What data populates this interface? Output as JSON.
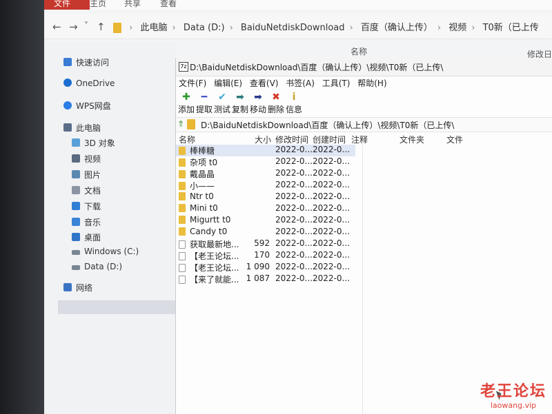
{
  "explorer": {
    "ribbon_tabs": [
      "文件",
      "主页",
      "共享",
      "查看"
    ],
    "nav_buttons": [
      "←",
      "→",
      "˅",
      "↑"
    ],
    "breadcrumbs": [
      "此电脑",
      "Data (D:)",
      "BaiduNetdiskDownload",
      "百度（确认上传）",
      "视频",
      "T0新（已上传"
    ],
    "column_name": "名称",
    "column_modified": "修改日",
    "nav_items": [
      {
        "label": "快速访问",
        "color": "#3a7bd5"
      },
      {
        "label": "OneDrive",
        "color": "#1b6fd1"
      },
      {
        "label": "WPS网盘",
        "color": "#2c7ee6"
      },
      {
        "label": "此电脑",
        "color": "#5a6d8a"
      },
      {
        "label": "3D 对象",
        "color": "#5aa0d8"
      },
      {
        "label": "视频",
        "color": "#5b6b80"
      },
      {
        "label": "图片",
        "color": "#5b88b0"
      },
      {
        "label": "文档",
        "color": "#8a94a3"
      },
      {
        "label": "下载",
        "color": "#2f7fd6"
      },
      {
        "label": "音乐",
        "color": "#3a84d8"
      },
      {
        "label": "桌面",
        "color": "#2f74c8"
      },
      {
        "label": "Windows (C:)",
        "color": "#7a8593"
      },
      {
        "label": "Data (D:)",
        "color": "#7a8593"
      },
      {
        "label": "网络",
        "color": "#3b74c4"
      }
    ]
  },
  "archiver": {
    "title": "D:\\BaiduNetdiskDownload\\百度（确认上传）\\视频\\T0新（已上传\\",
    "app_icon": "7z",
    "menu": [
      "文件(F)",
      "编辑(E)",
      "查看(V)",
      "书签(A)",
      "工具(T)",
      "帮助(H)"
    ],
    "toolbar": [
      {
        "label": "添加",
        "icon": "plus-icon",
        "glyph": "✚",
        "color": "#2e9a2e"
      },
      {
        "label": "提取",
        "icon": "minus-icon",
        "glyph": "━",
        "color": "#4a55c8"
      },
      {
        "label": "测试",
        "icon": "check-icon",
        "glyph": "✔",
        "color": "#3aa6d0"
      },
      {
        "label": "复制",
        "icon": "copy-arrow-icon",
        "glyph": "➡",
        "color": "#2a7a7a"
      },
      {
        "label": "移动",
        "icon": "move-arrow-icon",
        "glyph": "➡",
        "color": "#2a3a8a"
      },
      {
        "label": "删除",
        "icon": "delete-icon",
        "glyph": "✖",
        "color": "#d23a2a"
      },
      {
        "label": "信息",
        "icon": "info-icon",
        "glyph": "i",
        "color": "#c7a227"
      }
    ],
    "path": "D:\\BaiduNetdiskDownload\\百度（确认上传）\\视频\\T0新（已上传\\",
    "headers": {
      "name": "名称",
      "size": "大小",
      "modified": "修改时间",
      "created": "创建时间",
      "comment": "注释",
      "folders": "文件夹",
      "files": "文件"
    },
    "rows": [
      {
        "name": "棒棒糖",
        "size": "",
        "modified": "2022-0...",
        "created": "2022-0...",
        "type": "folder"
      },
      {
        "name": "杂项 t0",
        "size": "",
        "modified": "2022-0...",
        "created": "2022-0...",
        "type": "folder"
      },
      {
        "name": "戴晶晶",
        "size": "",
        "modified": "2022-0...",
        "created": "2022-0...",
        "type": "folder"
      },
      {
        "name": "小——",
        "size": "",
        "modified": "2022-0...",
        "created": "2022-0...",
        "type": "folder"
      },
      {
        "name": "Ntr t0",
        "size": "",
        "modified": "2022-0...",
        "created": "2022-0...",
        "type": "folder"
      },
      {
        "name": "Mini t0",
        "size": "",
        "modified": "2022-0...",
        "created": "2022-0...",
        "type": "folder"
      },
      {
        "name": "Migurtt t0",
        "size": "",
        "modified": "2022-0...",
        "created": "2022-0...",
        "type": "folder"
      },
      {
        "name": "Candy t0",
        "size": "",
        "modified": "2022-0...",
        "created": "2022-0...",
        "type": "folder"
      },
      {
        "name": "获取最新地...",
        "size": "592",
        "modified": "2022-0...",
        "created": "2022-0...",
        "type": "file"
      },
      {
        "name": "【老王论坛...",
        "size": "170",
        "modified": "2022-0...",
        "created": "2022-0...",
        "type": "file"
      },
      {
        "name": "【老王论坛...",
        "size": "1 090",
        "modified": "2022-0...",
        "created": "2022-0...",
        "type": "file"
      },
      {
        "name": "【来了就能...",
        "size": "1 087",
        "modified": "2022-0...",
        "created": "2022-0...",
        "type": "file"
      }
    ]
  },
  "watermark": {
    "line1": "老王论坛",
    "line2": "laowang.vip"
  }
}
